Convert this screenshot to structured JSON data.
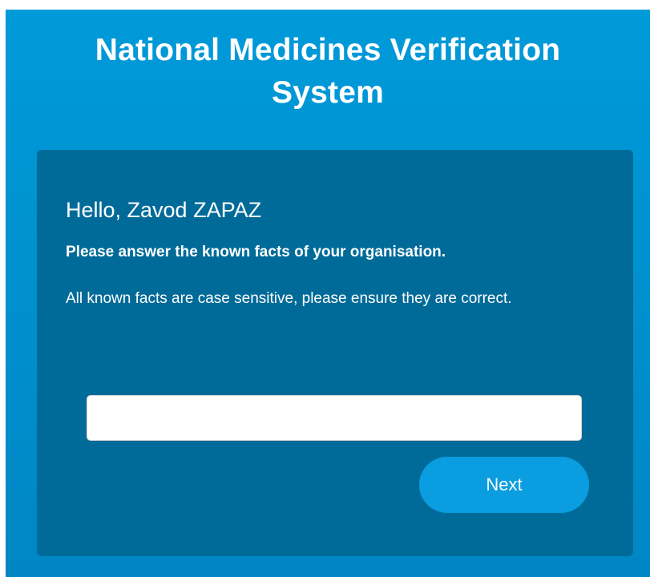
{
  "header": {
    "title_line1": "National Medicines Verification",
    "title_line2": "System"
  },
  "card": {
    "greeting": "Hello, Zavod ZAPAZ",
    "subheading": "Please answer the known facts of your organisation.",
    "info": "All known facts are case sensitive, please ensure they are correct.",
    "answer_value": "",
    "next_label": "Next"
  },
  "colors": {
    "background": "#009ad9",
    "card": "#006b99",
    "button": "#0a9ee0",
    "text": "#ffffff"
  }
}
